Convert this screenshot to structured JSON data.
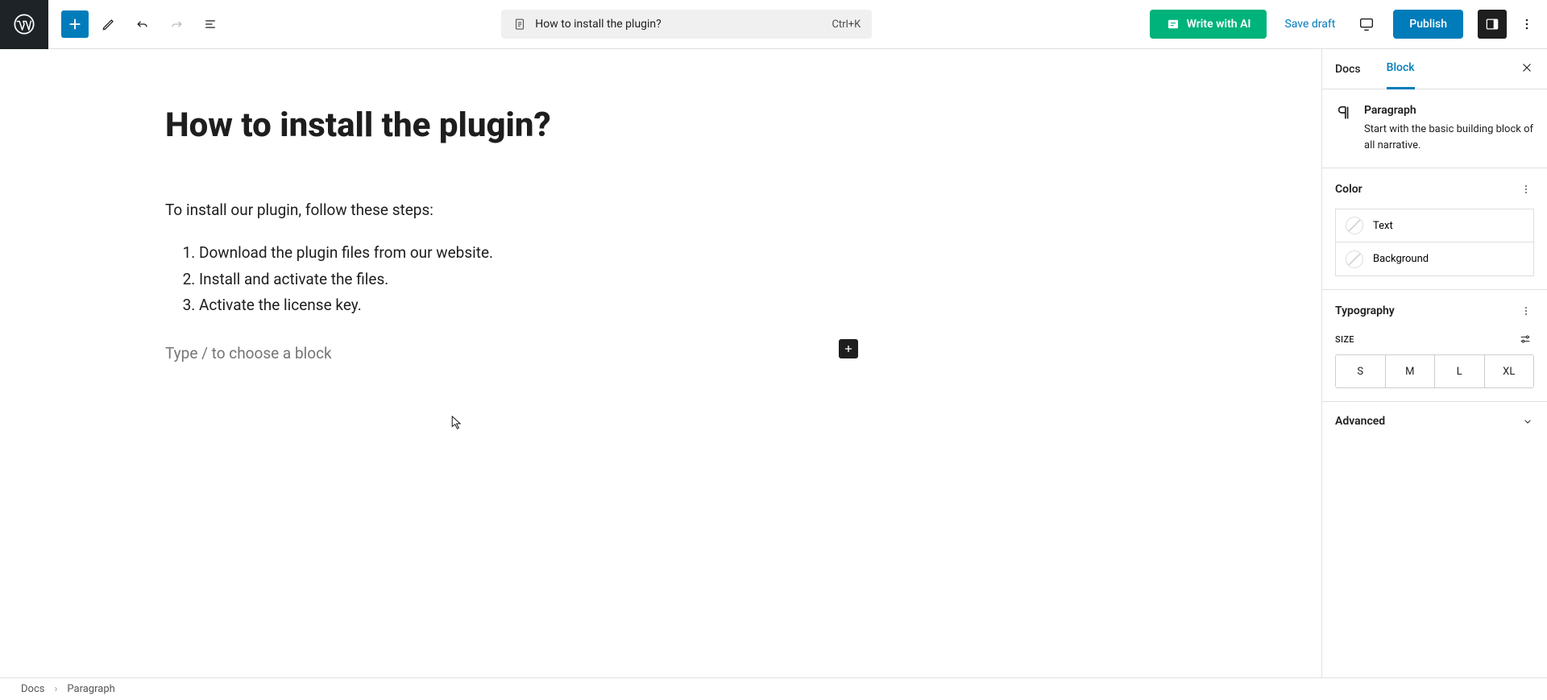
{
  "toolbar": {
    "doc_title": "How to install the plugin?",
    "shortcut": "Ctrl+K",
    "ai_label": "Write with AI",
    "save_label": "Save draft",
    "publish_label": "Publish"
  },
  "content": {
    "post_title": "How to install the plugin?",
    "intro": "To install our plugin, follow these steps:",
    "steps": [
      "Download the plugin files from our website.",
      "Install and activate the files.",
      "Activate the license key."
    ],
    "new_block_placeholder": "Type / to choose a block"
  },
  "sidepanel": {
    "tabs": {
      "docs": "Docs",
      "block": "Block"
    },
    "block_name": "Paragraph",
    "block_desc": "Start with the basic building block of all narrative.",
    "color_heading": "Color",
    "color_text": "Text",
    "color_background": "Background",
    "typo_heading": "Typography",
    "size_label": "SIZE",
    "sizes": [
      "S",
      "M",
      "L",
      "XL"
    ],
    "advanced": "Advanced"
  },
  "breadcrumb": {
    "root": "Docs",
    "current": "Paragraph"
  }
}
